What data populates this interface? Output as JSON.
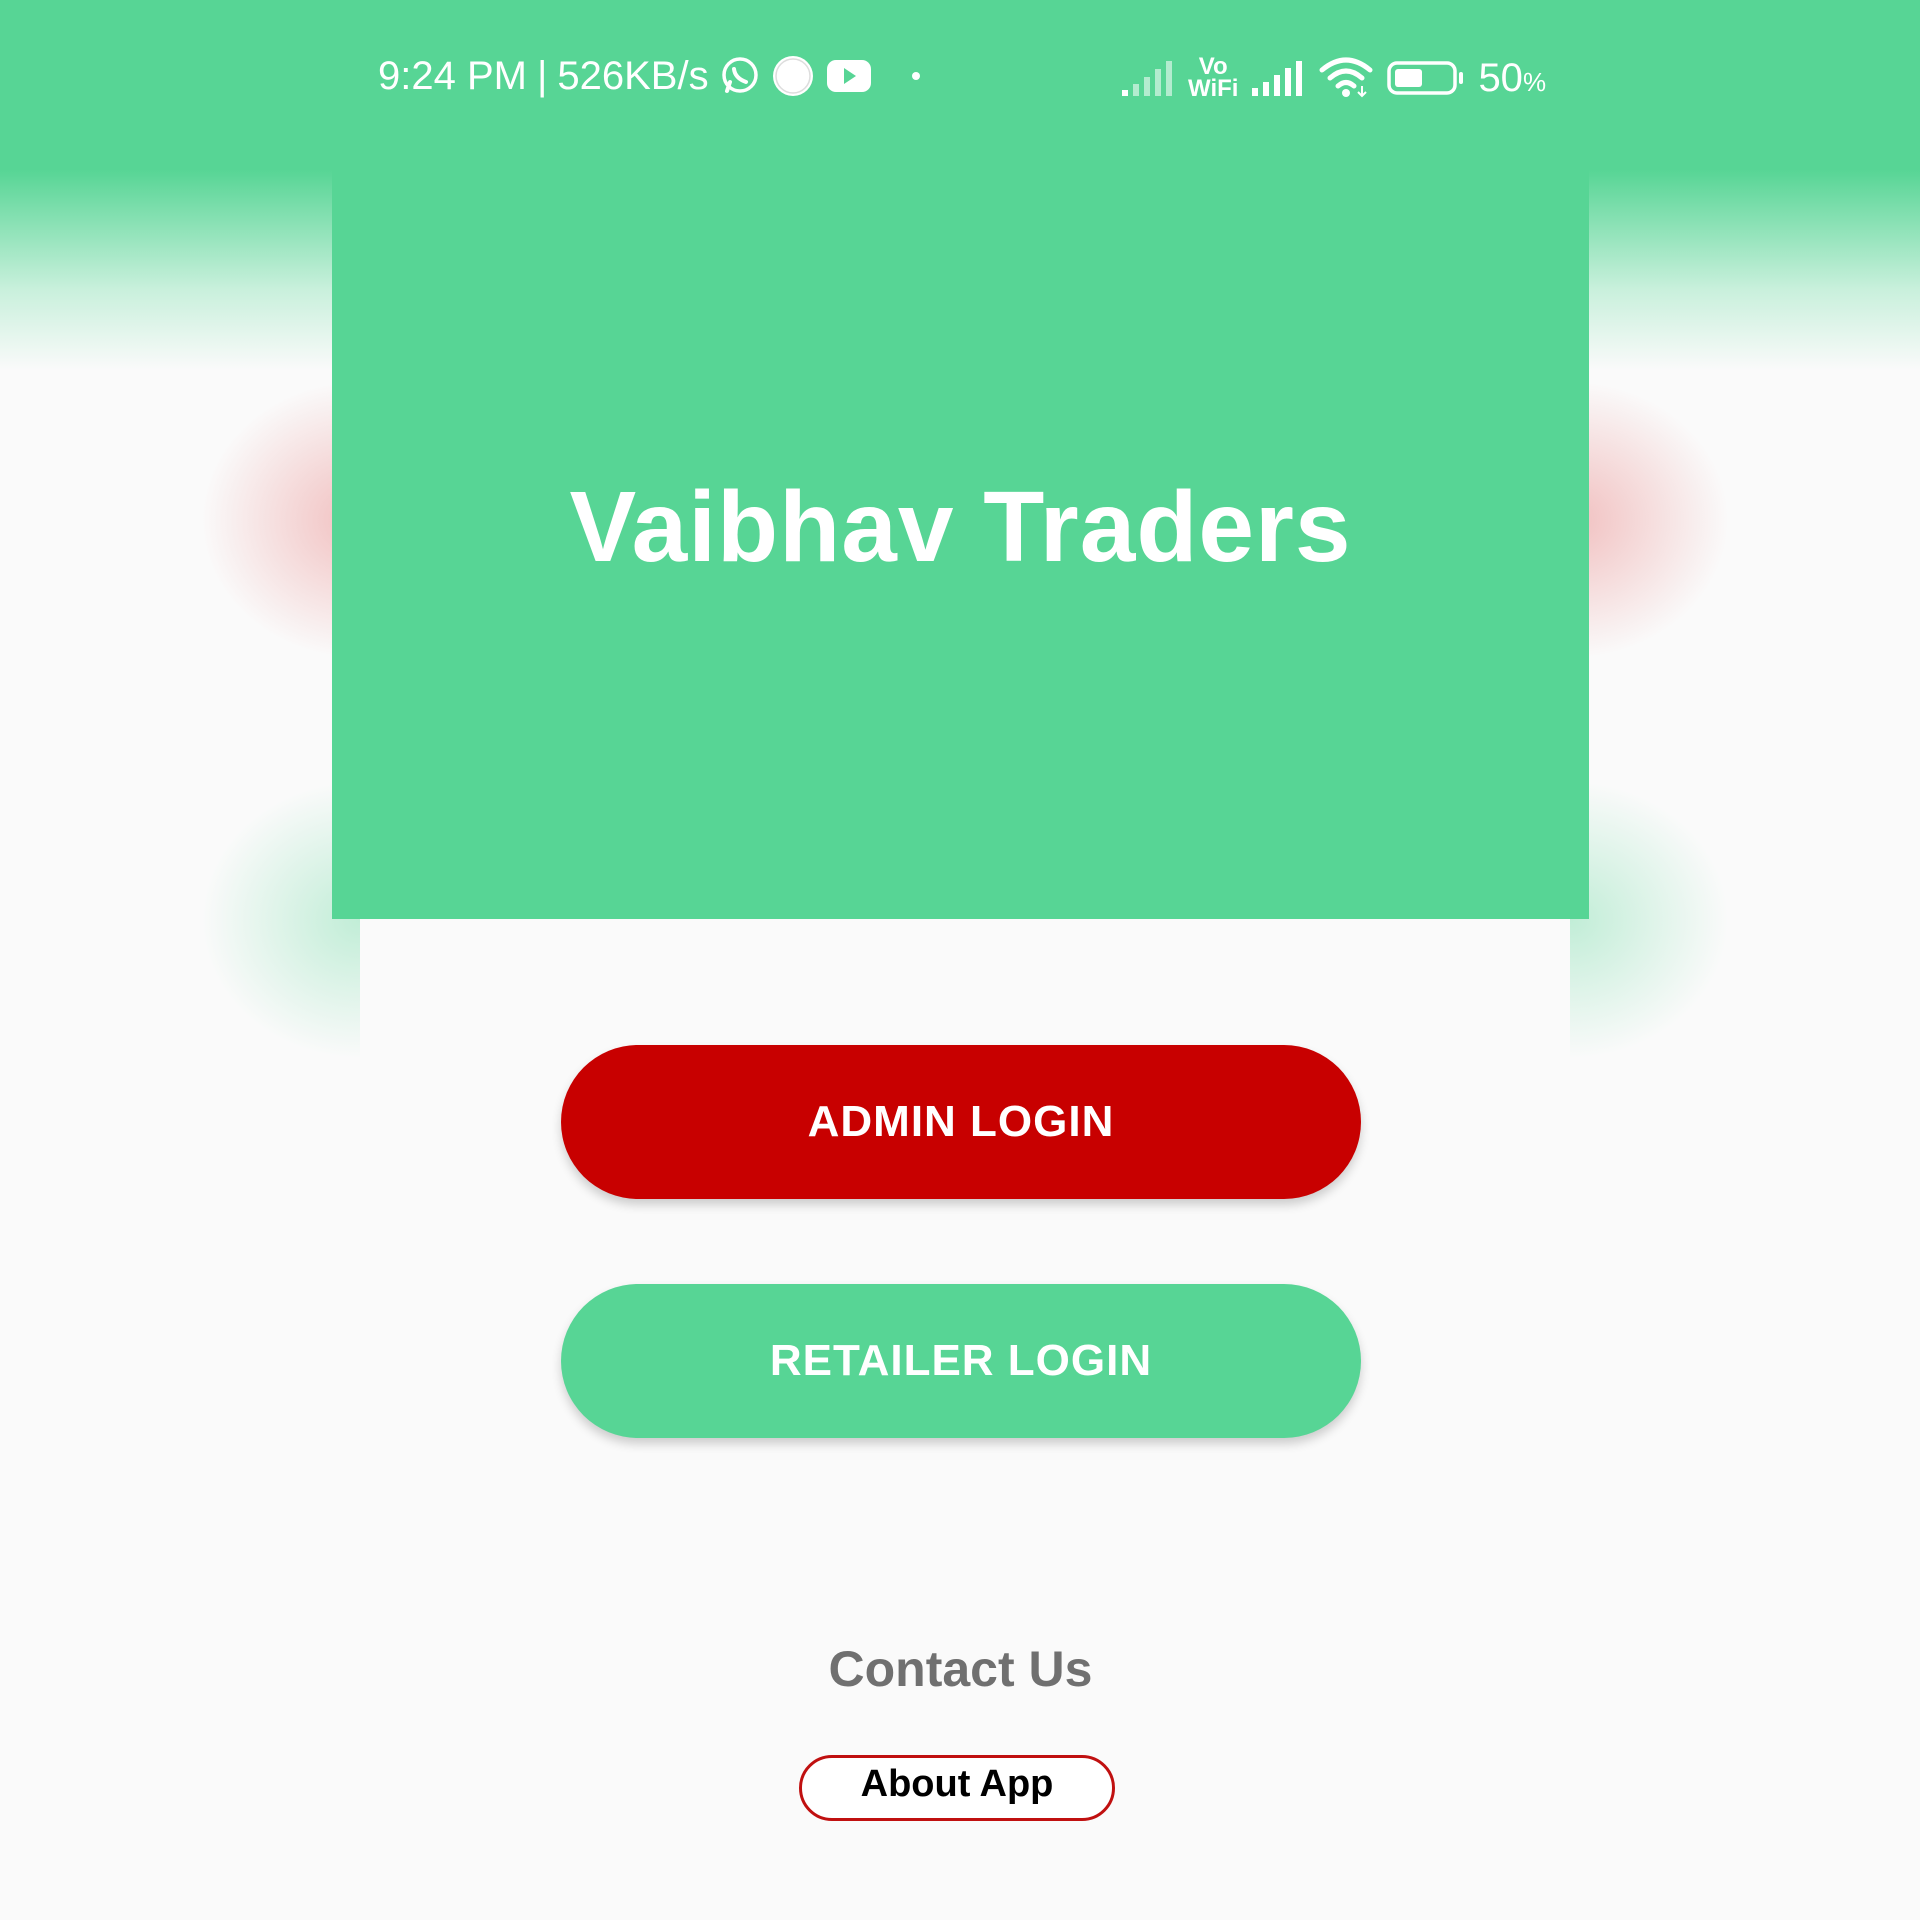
{
  "status_bar": {
    "time": "9:24 PM",
    "separator": "|",
    "speed": "526KB/s",
    "icons_left": [
      "whatsapp-icon",
      "circle-app-icon",
      "youtube-icon",
      "dot-icon"
    ],
    "vo": "Vo",
    "wifi_label": "WiFi",
    "battery_percent": "50",
    "battery_unit": "%",
    "battery_level": 0.5
  },
  "header": {
    "app_title": "Vaibhav Traders"
  },
  "actions": {
    "admin_login": "ADMIN LOGIN",
    "retailer_login": "RETAILER LOGIN"
  },
  "footer": {
    "contact_us": "Contact Us",
    "about_app": "About App"
  },
  "colors": {
    "primary_green": "#57d595",
    "admin_red": "#c80000",
    "background": "#fafafa",
    "contact_gray": "#707070"
  }
}
